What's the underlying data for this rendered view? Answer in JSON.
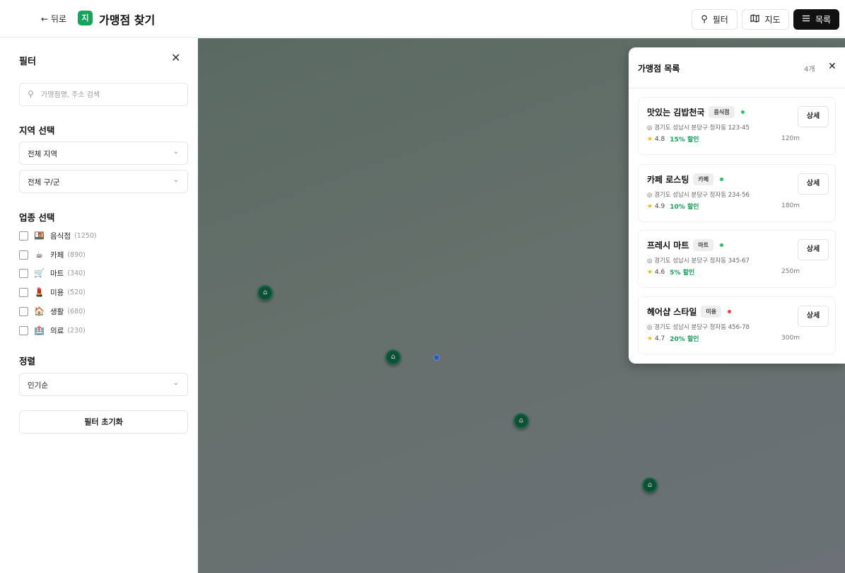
{
  "header": {
    "back_label": "← 뒤로",
    "logo_text": "지",
    "title": "가맹점 찾기",
    "buttons": {
      "filter": {
        "icon": "search-icon",
        "label": "필터"
      },
      "map": {
        "icon": "map-icon",
        "label": "지도"
      },
      "list": {
        "icon": "list-icon",
        "label": "목록"
      }
    }
  },
  "sidebar": {
    "title": "필터",
    "search_placeholder": "가맹점명, 주소 검색",
    "region_title": "지역 선택",
    "region_select": "전체 지역",
    "district_select": "전체 구/군",
    "category_title": "업종 선택",
    "categories": [
      {
        "label": "음식점",
        "count": "(1250)",
        "icon": "restaurant-icon"
      },
      {
        "label": "카페",
        "count": "(890)",
        "icon": "cafe-icon"
      },
      {
        "label": "마트",
        "count": "(340)",
        "icon": "cart-icon"
      },
      {
        "label": "미용",
        "count": "(520)",
        "icon": "beauty-icon"
      },
      {
        "label": "생활",
        "count": "(680)",
        "icon": "home-icon"
      },
      {
        "label": "의료",
        "count": "(230)",
        "icon": "medical-icon"
      }
    ],
    "sort_title": "정렬",
    "sort_select": "인기순",
    "reset_label": "필터 초기화"
  },
  "panel": {
    "title": "가맹점 목록",
    "count": "4개",
    "items": [
      {
        "name": "맛있는 김밥천국",
        "category": "음식점",
        "status_color": "#22c55e",
        "address": "경기도 성남시 분당구 정자동 123-45",
        "rating": "4.8",
        "discount": "15% 할인",
        "distance": "120m",
        "detail_label": "상세"
      },
      {
        "name": "카페 로스팅",
        "category": "카페",
        "status_color": "#22c55e",
        "address": "경기도 성남시 분당구 정자동 234-56",
        "rating": "4.9",
        "discount": "10% 할인",
        "distance": "180m",
        "detail_label": "상세"
      },
      {
        "name": "프레시 마트",
        "category": "마트",
        "status_color": "#22c55e",
        "address": "경기도 성남시 분당구 정자동 345-67",
        "rating": "4.6",
        "discount": "5% 할인",
        "distance": "250m",
        "detail_label": "상세"
      },
      {
        "name": "헤어샵 스타일",
        "category": "미용",
        "status_color": "#ef4444",
        "address": "경기도 성남시 분당구 정자동 456-78",
        "rating": "4.7",
        "discount": "20% 할인",
        "distance": "300m",
        "detail_label": "상세"
      }
    ]
  },
  "map": {
    "marker_icon": "store-icon",
    "markers": 4
  },
  "colors": {
    "brand": "#16a35a",
    "marker": "#0f4f37",
    "user_location": "#2e5ab8"
  }
}
